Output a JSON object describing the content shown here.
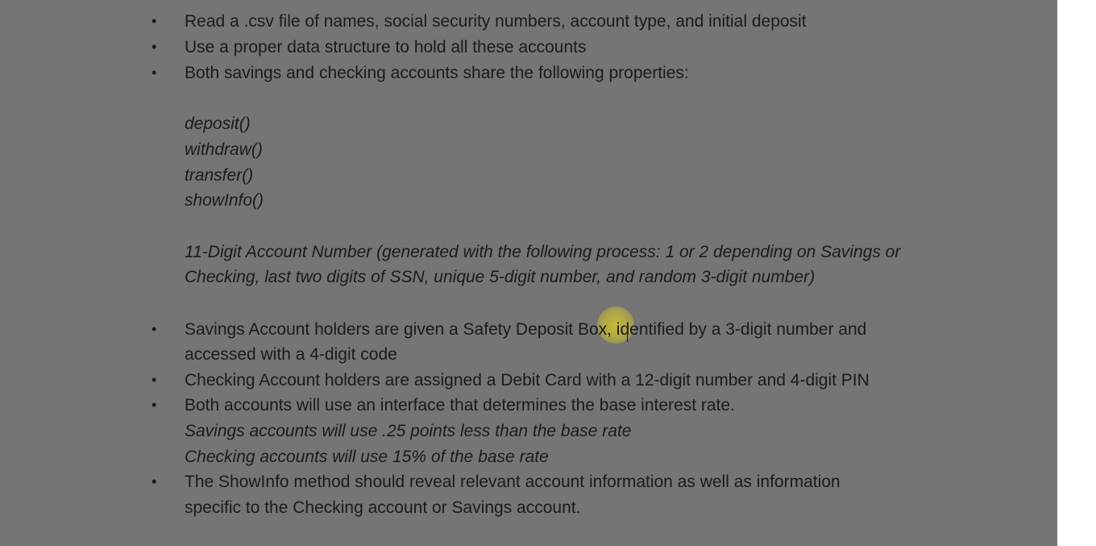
{
  "requirements": {
    "bullets_top": [
      "Read a .csv file of names, social security numbers, account type, and initial deposit",
      "Use a proper data structure to hold all these accounts",
      "Both savings and checking accounts share the following properties:"
    ],
    "methods": [
      "deposit()",
      "withdraw()",
      "transfer()",
      "showInfo()"
    ],
    "account_number_lines": [
      "11-Digit Account Number (generated with the following process: 1 or 2 depending on Savings or",
      "Checking, last two digits of SSN, unique 5-digit number, and random 3-digit number)"
    ],
    "savings_bullet": [
      "Savings Account holders are given a Safety Deposit Box, identified by a 3-digit number and",
      "accessed with a 4-digit code"
    ],
    "checking_bullet": "Checking Account holders are assigned a Debit Card with a 12-digit number and 4-digit PIN",
    "interest_bullet": "Both accounts will use an interface that determines the base interest rate.",
    "interest_details": [
      "Savings accounts will use .25 points less than the base rate",
      "Checking accounts will use 15% of the base rate"
    ],
    "showinfo_bullet": [
      "The ShowInfo method should reveal relevant account information as well as information",
      "specific to the Checking account or Savings account."
    ],
    "bullet_symbol": "•"
  },
  "colors": {
    "page_overlay": "#757575",
    "text": "#1b1b1b",
    "cursor_highlight": "#d6c828"
  }
}
